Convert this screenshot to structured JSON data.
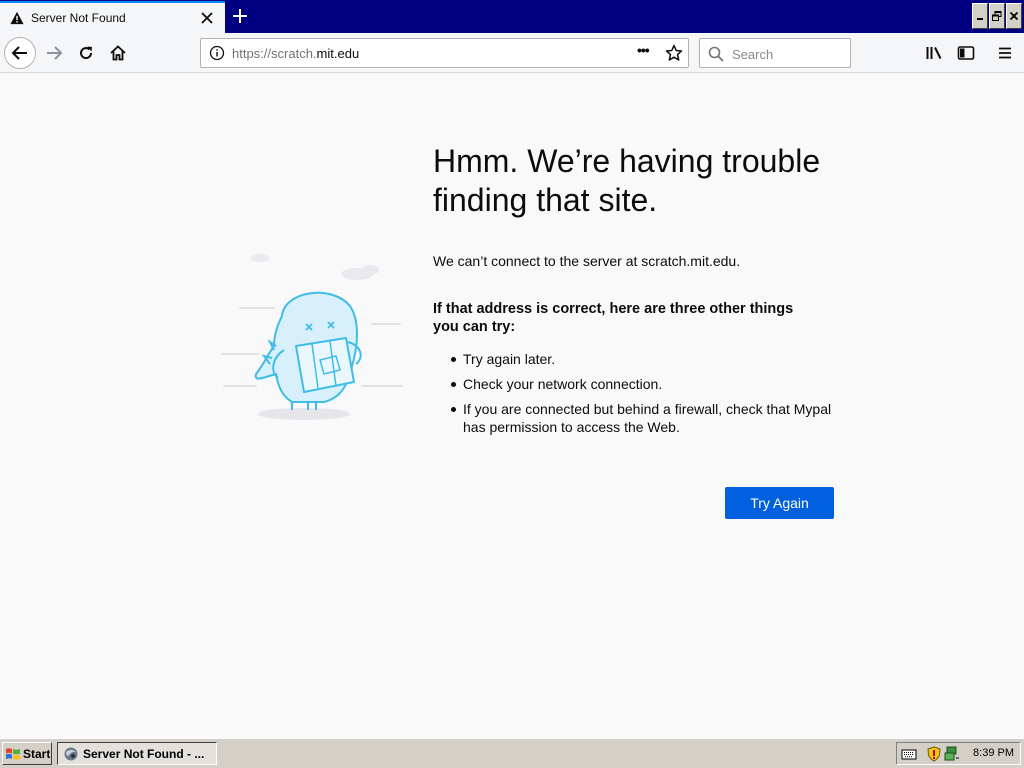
{
  "browser": {
    "tab": {
      "title": "Server Not Found"
    },
    "urlbar": {
      "prefix": "https://scratch.",
      "domain": "mit.edu"
    },
    "search": {
      "placeholder": "Search"
    }
  },
  "error_page": {
    "title_line1": "Hmm. We’re having trouble",
    "title_line2": "finding that site.",
    "description": "We can’t connect to the server at scratch.mit.edu.",
    "suggestions_heading_line1": "If that address is correct, here are three other things",
    "suggestions_heading_line2": "you can try:",
    "suggestions": [
      "Try again later.",
      "Check your network connection.",
      "If you are connected but behind a firewall, check that Mypal has permission to access the Web."
    ],
    "try_again_label": "Try Again"
  },
  "taskbar": {
    "start_label": "Start",
    "task_label": "Server Not Found - ...",
    "clock": "8:39 PM"
  },
  "colors": {
    "title_bar": "#000080",
    "accent_button": "#0060df",
    "page_background": "#f9f9fa"
  }
}
